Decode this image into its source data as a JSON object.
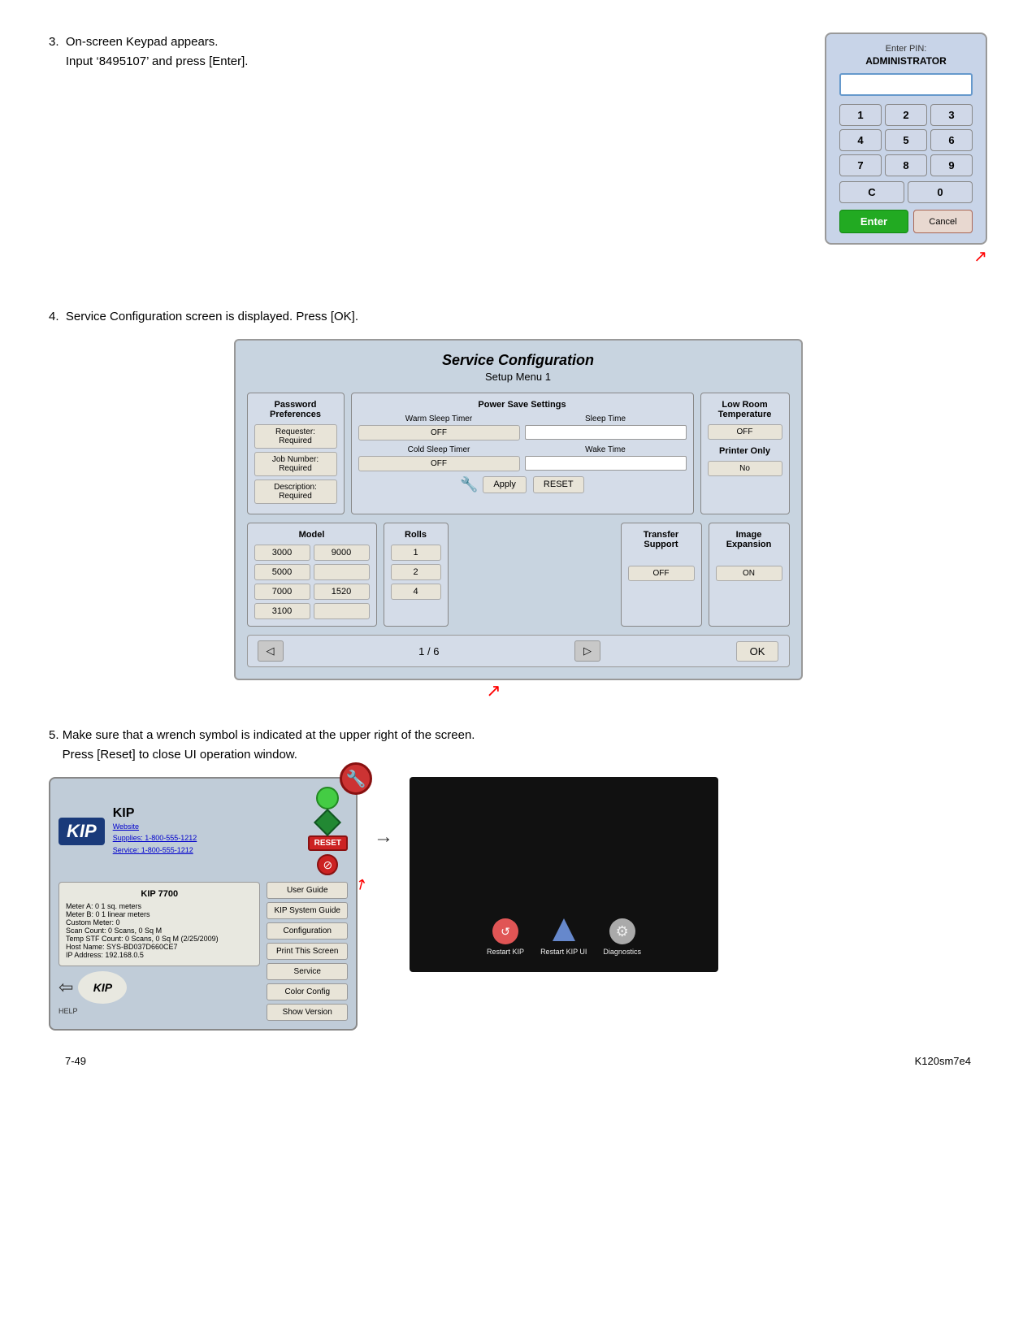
{
  "steps": {
    "step3": {
      "number": "3.",
      "text": "On-screen Keypad appears.",
      "text2": "Input ‘8495107’ and press [Enter]."
    },
    "step4": {
      "number": "4.",
      "text": "Service Configuration screen is displayed. Press [OK]."
    },
    "step5": {
      "number": "5.",
      "text": "Make sure that a wrench symbol is indicated at the upper right of the screen.",
      "text2": "Press [Reset] to close UI operation window."
    }
  },
  "keypad": {
    "title": "Enter PIN:",
    "subtitle": "ADMINISTRATOR",
    "keys": [
      "1",
      "2",
      "3",
      "4",
      "5",
      "6",
      "7",
      "8",
      "9"
    ],
    "special_left": "C",
    "special_right": "0",
    "enter_label": "Enter",
    "cancel_label": "Cancel"
  },
  "service_config": {
    "title": "Service Configuration",
    "subtitle": "Setup Menu 1",
    "password_label": "Password Preferences",
    "pref_btn1": "Requester: Required",
    "pref_btn2": "Job Number: Required",
    "pref_btn3": "Description: Required",
    "power_save_label": "Power Save Settings",
    "warm_sleep_label": "Warm Sleep Timer",
    "warm_sleep_value": "OFF",
    "cold_sleep_label": "Cold Sleep Timer",
    "cold_sleep_value": "OFF",
    "sleep_time_label": "Sleep Time",
    "wake_time_label": "Wake Time",
    "apply_label": "Apply",
    "reset_label": "RESET",
    "low_room_label": "Low Room Temperature",
    "low_room_value": "OFF",
    "printer_only_label": "Printer Only",
    "printer_only_value": "No",
    "model_label": "Model",
    "model_items": [
      "3000",
      "9000",
      "5000",
      "",
      "7000",
      "1520",
      "3100",
      ""
    ],
    "rolls_label": "Rolls",
    "rolls_items": [
      "1",
      "2",
      "4"
    ],
    "transfer_label": "Transfer Support",
    "transfer_value": "OFF",
    "image_label": "Image Expansion",
    "image_value": "ON",
    "nav_prev": "◁",
    "nav_page": "1 / 6",
    "nav_next": "▷",
    "nav_ok": "OK"
  },
  "kip_screen": {
    "logo": "KIP",
    "title": "KIP",
    "website_label": "Website",
    "supplies_label": "Supplies: 1-800-555-1212",
    "service_label": "Service: 1-800-555-1212",
    "device_title": "KIP 7700",
    "meter_a": "Meter A: 0  1 sq. meters",
    "meter_b": "Meter B: 0  1 linear meters",
    "custom_meter": "Custom Meter: 0",
    "scan_count": "Scan Count: 0 Scans, 0 Sq M",
    "temp_count": "Temp STF Count: 0 Scans, 0 Sq M (2/25/2009)",
    "host_name": "Host Name: SYS-BD037D660CE7",
    "ip_address": "IP Address: 192.168.0.5",
    "user_guide": "User Guide",
    "kip_system_guide": "KIP System Guide",
    "configuration": "Configuration",
    "print_screen": "Print This Screen",
    "service": "Service",
    "color_config": "Color Config",
    "show_version": "Show Version",
    "reset_label": "RESET",
    "help_label": "HELP"
  },
  "black_screen_icons": {
    "icon1_label": "Restart KIP",
    "icon2_label": "Restart KIP UI",
    "icon3_label": "Diagnostics"
  },
  "footer": {
    "page_number": "7-49",
    "doc_ref": "K120sm7e4"
  }
}
